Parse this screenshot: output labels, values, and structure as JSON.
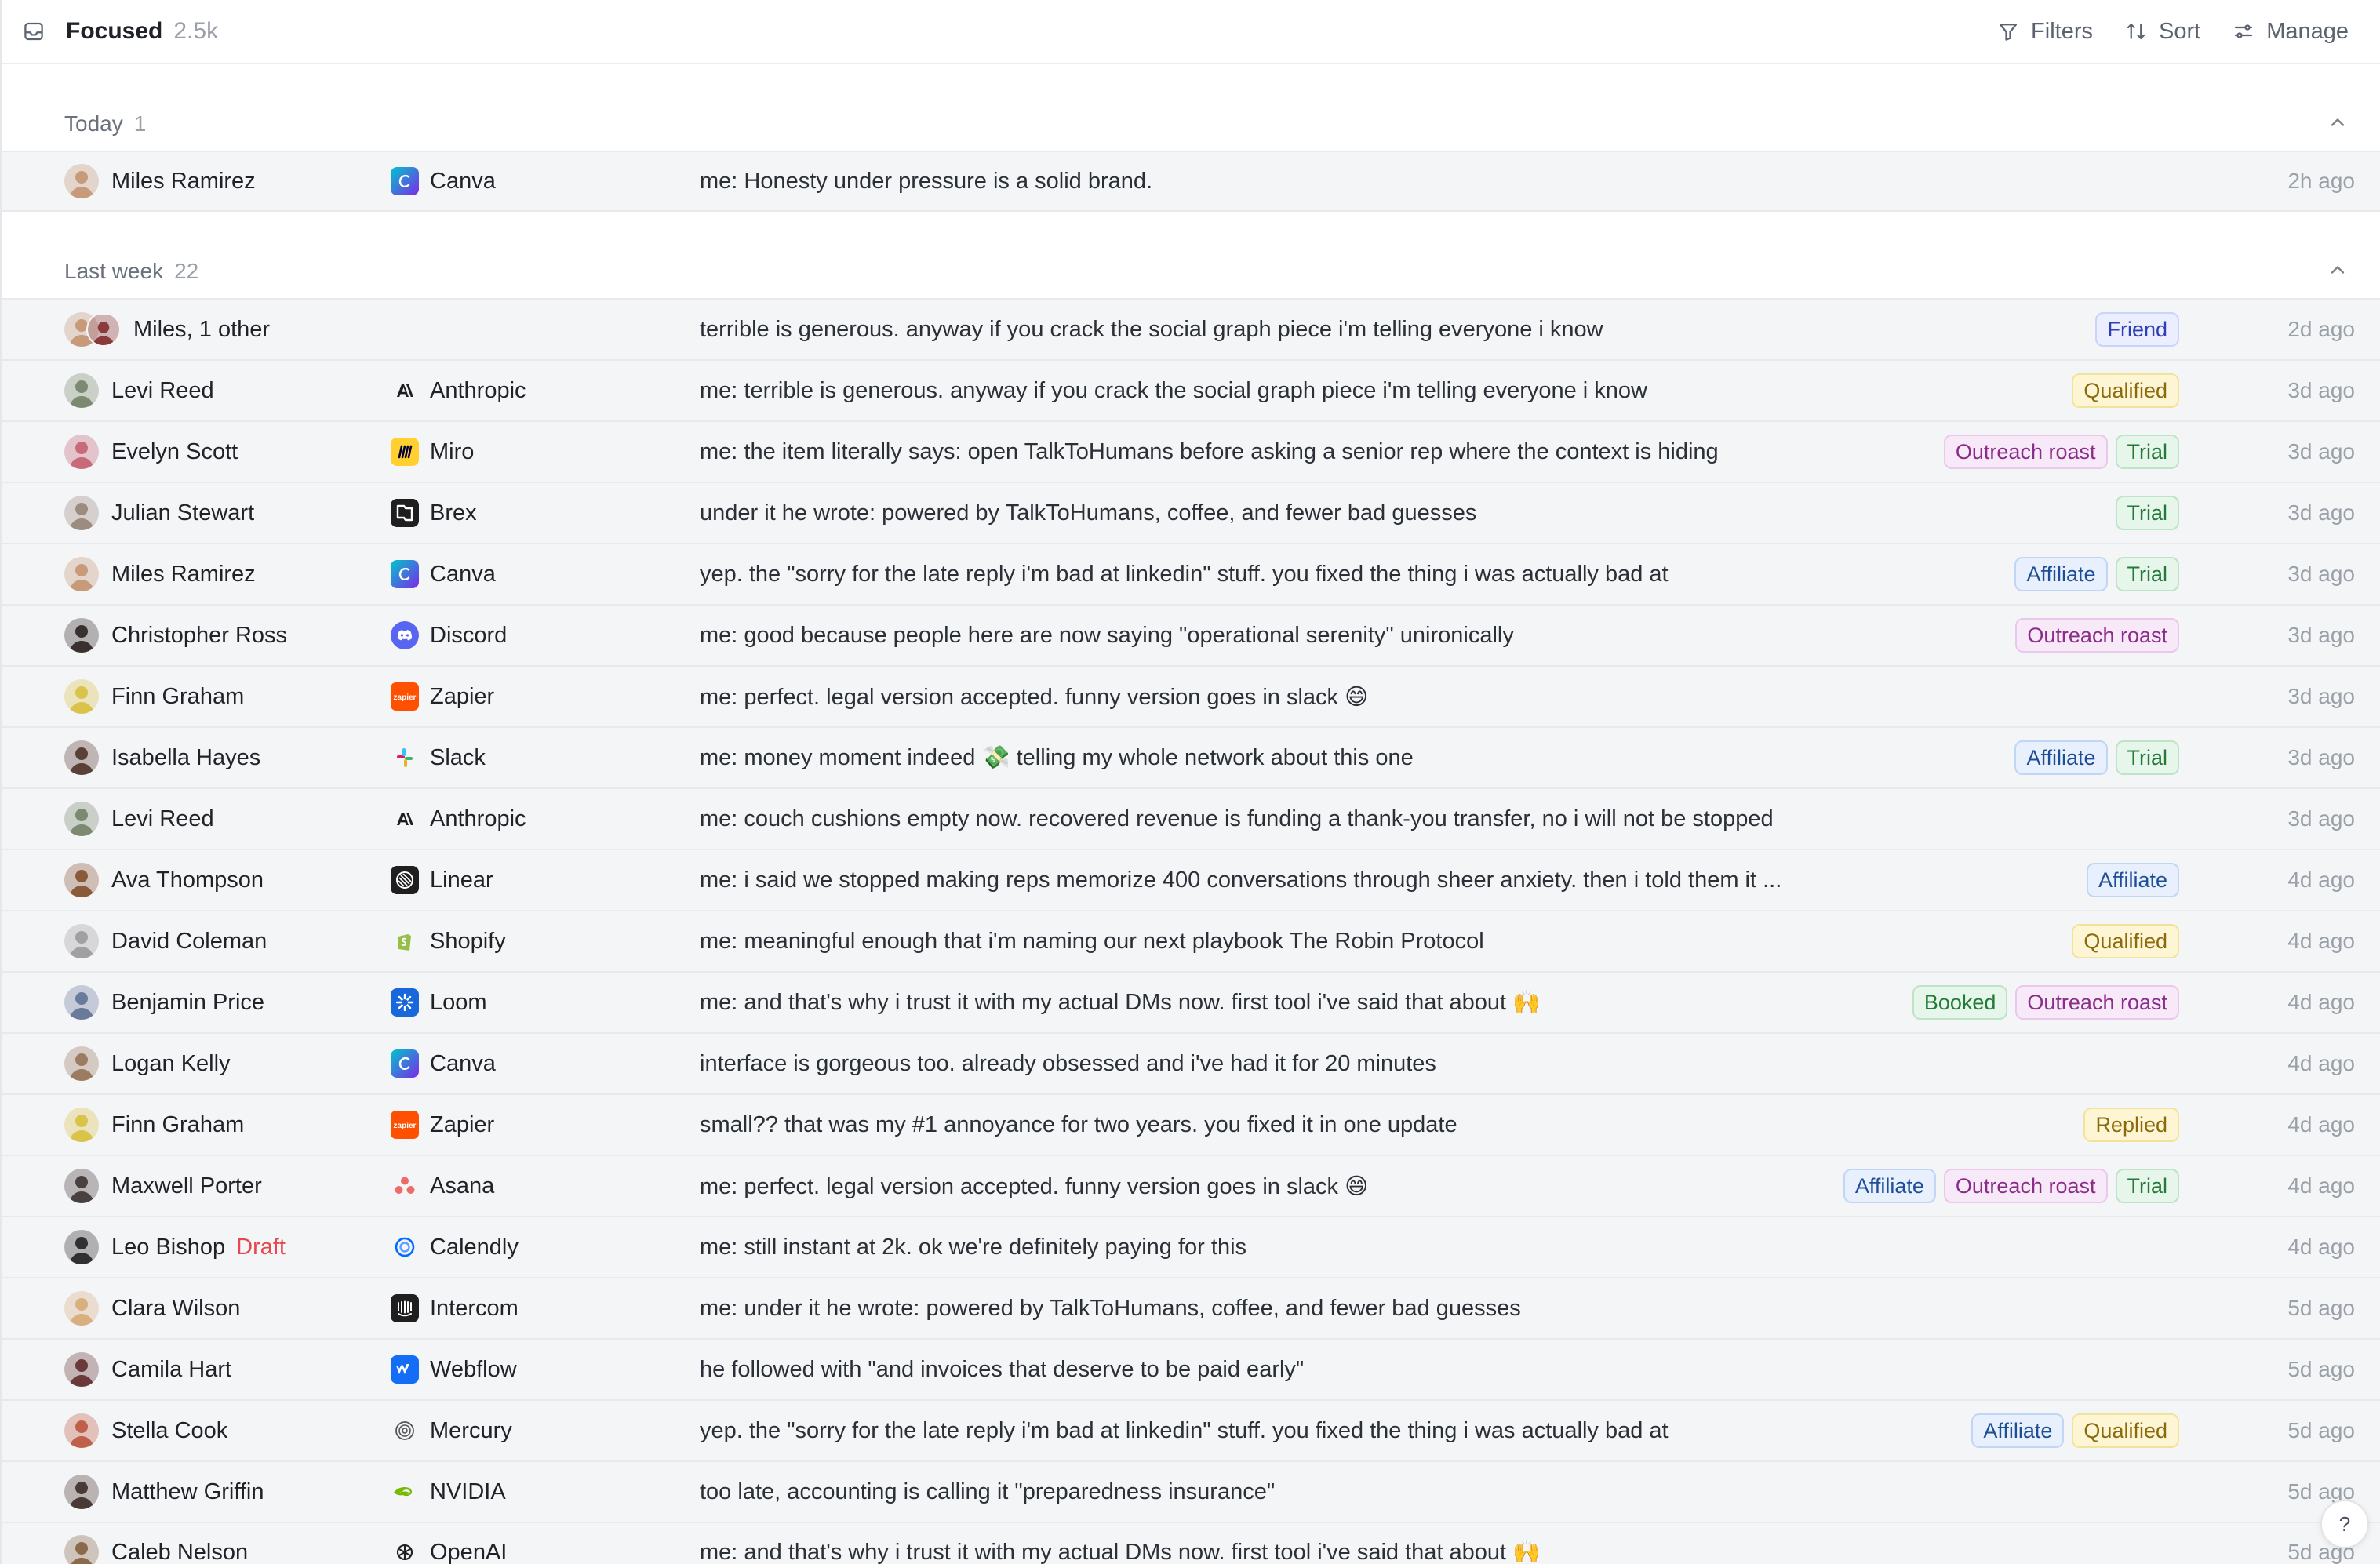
{
  "header": {
    "title": "Focused",
    "count": "2.5k",
    "filters_label": "Filters",
    "sort_label": "Sort",
    "manage_label": "Manage"
  },
  "sections": [
    {
      "label": "Today",
      "count": "1",
      "rows": [
        {
          "avatar_color": "#c79a7a",
          "name": "Miles Ramirez",
          "company": "Canva",
          "logo": "canva",
          "message": "me: Honesty under pressure is a solid brand.",
          "tags": [],
          "time": "2h ago"
        }
      ]
    },
    {
      "label": "Last week",
      "count": "22",
      "rows": [
        {
          "group": true,
          "name": "Miles, 1 other",
          "company": "",
          "logo": "",
          "message": "terrible is generous. anyway if you crack the social graph piece i'm telling everyone i know",
          "tags": [
            {
              "label": "Friend",
              "kind": "friend"
            }
          ],
          "time": "2d ago"
        },
        {
          "avatar_color": "#7b8a70",
          "name": "Levi Reed",
          "company": "Anthropic",
          "logo": "anthropic",
          "message": "me: terrible is generous. anyway if you crack the social graph piece i'm telling everyone i know",
          "tags": [
            {
              "label": "Qualified",
              "kind": "qualified"
            }
          ],
          "time": "3d ago"
        },
        {
          "avatar_color": "#c76a7a",
          "name": "Evelyn Scott",
          "company": "Miro",
          "logo": "miro",
          "message": "me: the item literally says: open TalkToHumans before asking a senior rep where the context is hiding",
          "tags": [
            {
              "label": "Outreach roast",
              "kind": "roast"
            },
            {
              "label": "Trial",
              "kind": "trial"
            }
          ],
          "time": "3d ago"
        },
        {
          "avatar_color": "#9c8c80",
          "name": "Julian Stewart",
          "company": "Brex",
          "logo": "brex",
          "message": "under it he wrote: powered by TalkToHumans, coffee, and fewer bad guesses",
          "tags": [
            {
              "label": "Trial",
              "kind": "trial"
            }
          ],
          "time": "3d ago"
        },
        {
          "avatar_color": "#c79a7a",
          "name": "Miles Ramirez",
          "company": "Canva",
          "logo": "canva",
          "message": "yep. the \"sorry for the late reply i'm bad at linkedin\" stuff. you fixed the thing i was actually bad at",
          "tags": [
            {
              "label": "Affiliate",
              "kind": "affiliate"
            },
            {
              "label": "Trial",
              "kind": "trial"
            }
          ],
          "time": "3d ago"
        },
        {
          "avatar_color": "#3a3030",
          "name": "Christopher Ross",
          "company": "Discord",
          "logo": "discord",
          "message": "me: good because people here are now saying \"operational serenity\" unironically",
          "tags": [
            {
              "label": "Outreach roast",
              "kind": "roast"
            }
          ],
          "time": "3d ago"
        },
        {
          "avatar_color": "#d9c34a",
          "name": "Finn Graham",
          "company": "Zapier",
          "logo": "zapier",
          "message": "me: perfect. legal version accepted. funny version goes in slack 😄",
          "tags": [],
          "time": "3d ago"
        },
        {
          "avatar_color": "#5a4036",
          "name": "Isabella Hayes",
          "company": "Slack",
          "logo": "slack",
          "message": "me: money moment indeed 💸 telling my whole network about this one",
          "tags": [
            {
              "label": "Affiliate",
              "kind": "affiliate"
            },
            {
              "label": "Trial",
              "kind": "trial"
            }
          ],
          "time": "3d ago"
        },
        {
          "avatar_color": "#7b8a70",
          "name": "Levi Reed",
          "company": "Anthropic",
          "logo": "anthropic",
          "message": "me: couch cushions empty now. recovered revenue is funding a thank-you transfer, no i will not be stopped",
          "tags": [],
          "time": "3d ago"
        },
        {
          "avatar_color": "#8a5a3a",
          "name": "Ava Thompson",
          "company": "Linear",
          "logo": "linear",
          "message": "me: i said we stopped making reps memorize 400 conversations through sheer anxiety. then i told them it ...",
          "tags": [
            {
              "label": "Affiliate",
              "kind": "affiliate"
            }
          ],
          "time": "4d ago"
        },
        {
          "avatar_color": "#a0a0a0",
          "name": "David Coleman",
          "company": "Shopify",
          "logo": "shopify",
          "message": "me: meaningful enough that i'm naming our next playbook The Robin Protocol",
          "tags": [
            {
              "label": "Qualified",
              "kind": "qualified"
            }
          ],
          "time": "4d ago"
        },
        {
          "avatar_color": "#6a7a9a",
          "name": "Benjamin Price",
          "company": "Loom",
          "logo": "loom",
          "message": "me: and that's why i trust it with my actual DMs now. first tool i've said that about 🙌",
          "tags": [
            {
              "label": "Booked",
              "kind": "booked"
            },
            {
              "label": "Outreach roast",
              "kind": "roast"
            }
          ],
          "time": "4d ago"
        },
        {
          "avatar_color": "#9c7c60",
          "name": "Logan Kelly",
          "company": "Canva",
          "logo": "canva",
          "message": "interface is gorgeous too. already obsessed and i've had it for 20 minutes",
          "tags": [],
          "time": "4d ago"
        },
        {
          "avatar_color": "#d9c34a",
          "name": "Finn Graham",
          "company": "Zapier",
          "logo": "zapier",
          "message": "small?? that was my #1 annoyance for two years. you fixed it in one update",
          "tags": [
            {
              "label": "Replied",
              "kind": "replied"
            }
          ],
          "time": "4d ago"
        },
        {
          "avatar_color": "#4a4040",
          "name": "Maxwell Porter",
          "company": "Asana",
          "logo": "asana",
          "message": "me: perfect. legal version accepted. funny version goes in slack 😄",
          "tags": [
            {
              "label": "Affiliate",
              "kind": "affiliate"
            },
            {
              "label": "Outreach roast",
              "kind": "roast"
            },
            {
              "label": "Trial",
              "kind": "trial"
            }
          ],
          "time": "4d ago"
        },
        {
          "avatar_color": "#303030",
          "name": "Leo Bishop",
          "draft": "Draft",
          "company": "Calendly",
          "logo": "calendly",
          "message": "me: still instant at 2k. ok we're definitely paying for this",
          "tags": [],
          "time": "4d ago"
        },
        {
          "avatar_color": "#d8b080",
          "name": "Clara Wilson",
          "company": "Intercom",
          "logo": "intercom",
          "message": "me: under it he wrote: powered by TalkToHumans, coffee, and fewer bad guesses",
          "tags": [],
          "time": "5d ago"
        },
        {
          "avatar_color": "#6a3a3a",
          "name": "Camila Hart",
          "company": "Webflow",
          "logo": "webflow",
          "message": "he followed with \"and invoices that deserve to be paid early\"",
          "tags": [],
          "time": "5d ago"
        },
        {
          "avatar_color": "#c0604a",
          "name": "Stella Cook",
          "company": "Mercury",
          "logo": "mercury",
          "message": "yep. the \"sorry for the late reply i'm bad at linkedin\" stuff. you fixed the thing i was actually bad at",
          "tags": [
            {
              "label": "Affiliate",
              "kind": "affiliate"
            },
            {
              "label": "Qualified",
              "kind": "qualified"
            }
          ],
          "time": "5d ago"
        },
        {
          "avatar_color": "#4a3a36",
          "name": "Matthew Griffin",
          "company": "NVIDIA",
          "logo": "nvidia",
          "message": "too late, accounting is calling it \"preparedness insurance\"",
          "tags": [],
          "time": "5d ago"
        },
        {
          "avatar_color": "#8a6a4a",
          "name": "Caleb Nelson",
          "company": "OpenAI",
          "logo": "openai",
          "message": "me: and that's why i trust it with my actual DMs now. first tool i've said that about 🙌",
          "tags": [],
          "time": "5d ago"
        }
      ]
    }
  ],
  "help": {
    "label": "?"
  },
  "colors": {
    "accent": "#2f3eb5",
    "draft": "#e5484d",
    "row_bg": "#f4f5f7"
  }
}
